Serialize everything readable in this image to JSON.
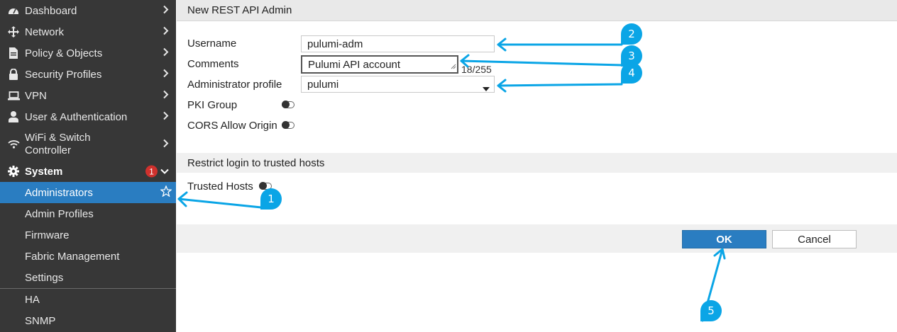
{
  "sidebar": {
    "items": [
      {
        "label": "Dashboard",
        "icon": "dashboard-icon"
      },
      {
        "label": "Network",
        "icon": "move-arrows-icon"
      },
      {
        "label": "Policy & Objects",
        "icon": "document-icon"
      },
      {
        "label": "Security Profiles",
        "icon": "lock-icon"
      },
      {
        "label": "VPN",
        "icon": "laptop-icon"
      },
      {
        "label": "User & Authentication",
        "icon": "user-icon"
      },
      {
        "label_line1": "WiFi & Switch",
        "label_line2": "Controller",
        "icon": "wifi-icon"
      },
      {
        "label": "System",
        "icon": "gear-icon",
        "badge": "1"
      }
    ],
    "system_submenu": [
      {
        "label": "Administrators",
        "active": true
      },
      {
        "label": "Admin Profiles"
      },
      {
        "label": "Firmware"
      },
      {
        "label": "Fabric Management"
      },
      {
        "label": "Settings"
      },
      {
        "label": "HA"
      },
      {
        "label": "SNMP"
      }
    ]
  },
  "form": {
    "title": "New REST API Admin",
    "username_label": "Username",
    "username_value": "pulumi-adm",
    "comments_label": "Comments",
    "comments_value": "Pulumi API account",
    "comments_counter": "18/255",
    "admin_profile_label": "Administrator profile",
    "admin_profile_value": "pulumi",
    "pki_group_label": "PKI Group",
    "cors_label": "CORS Allow Origin",
    "trusted_section_title": "Restrict login to trusted hosts",
    "trusted_hosts_label": "Trusted Hosts",
    "ok_label": "OK",
    "cancel_label": "Cancel"
  },
  "annotations": {
    "color": "#0aa5e6",
    "callouts": [
      "1",
      "2",
      "3",
      "4",
      "5"
    ]
  },
  "colors": {
    "sidebar_bg": "#373737",
    "accent": "#2a7dc1",
    "badge": "#d0312d"
  }
}
